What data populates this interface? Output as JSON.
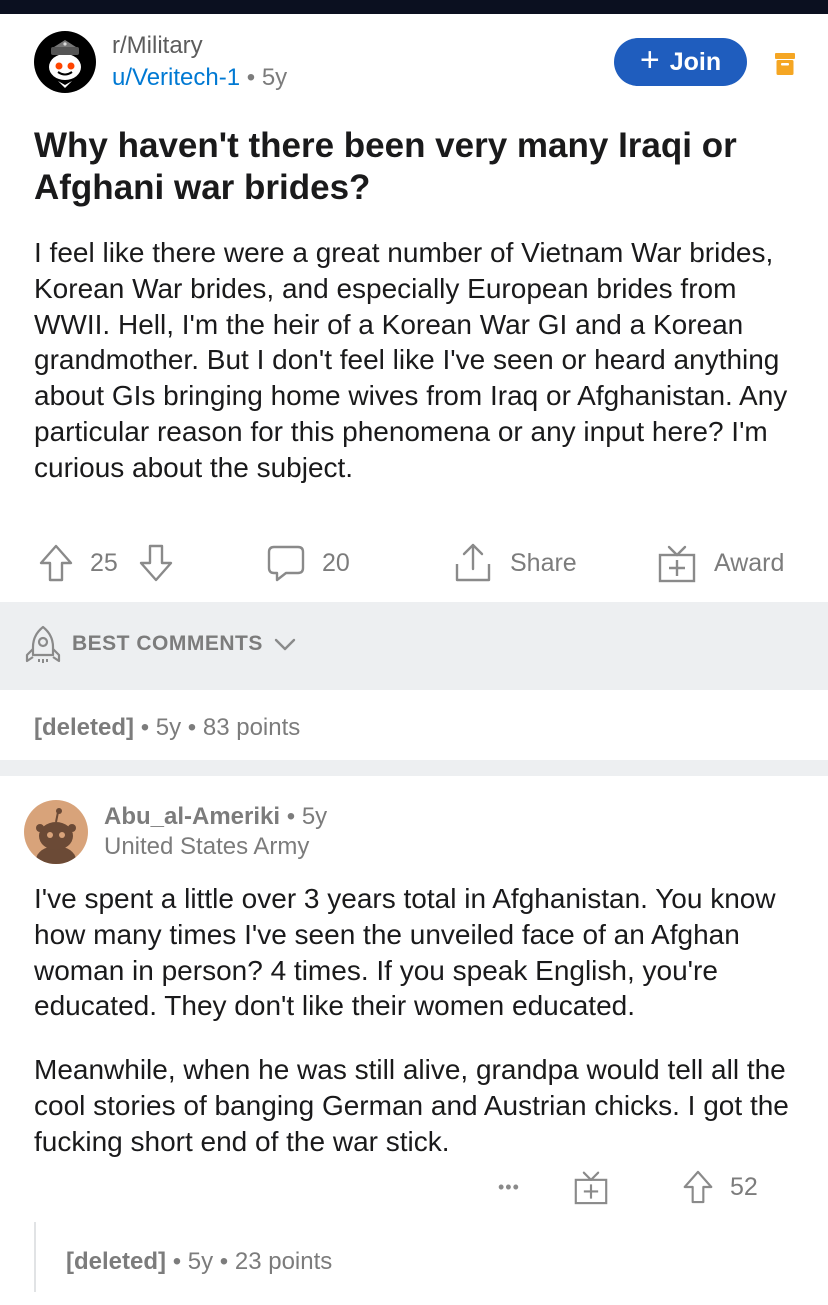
{
  "post": {
    "subreddit": "r/Military",
    "author": "u/Veritech-1",
    "separator": "•",
    "age": "5y",
    "join_label": "Join",
    "join_plus": "+",
    "title": "Why haven't there been very many Iraqi or Afghani war brides?",
    "body": "I feel like there were a great number of Vietnam War brides, Korean War brides, and especially European brides from WWII. Hell, I'm the heir of a Korean War GI and a Korean grandmother. But I don't feel like I've seen or heard anything about GIs bringing home wives from Iraq or Afghanistan. Any particular reason for this phenomena or any input here? I'm curious about the subject.",
    "votes": "25",
    "comments": "20",
    "share_label": "Share",
    "award_label": "Award"
  },
  "sort": {
    "label": "BEST COMMENTS"
  },
  "deleted_comment_1": {
    "author": "[deleted]",
    "separator": "•",
    "age": "5y",
    "points": "83 points"
  },
  "comment": {
    "author": "Abu_al-Ameriki",
    "separator": "•",
    "age": "5y",
    "flair": "United States Army",
    "paragraph_1": "I've spent a little over 3 years total in Afghanistan. You know how many times I've seen the unveiled face of an Afghan woman in person? 4 times. If you speak English, you're educated. They don't like their women educated.",
    "paragraph_2": "Meanwhile, when he was still alive, grandpa would tell all the cool stories of banging German and Austrian chicks. I got the fucking short end of the war stick.",
    "more_label": "•••",
    "votes": "52"
  },
  "deleted_comment_2": {
    "author": "[deleted]",
    "separator": "•",
    "age": "5y",
    "points": "23 points"
  },
  "colors": {
    "join_button": "#1f5dbe",
    "link_blue": "#0079d3",
    "meta_gray": "#7c7c7c",
    "band_gray": "#edeff1",
    "save_icon": "#f5a623"
  },
  "icons": [
    "subreddit-avatar",
    "save-icon",
    "upvote-icon",
    "downvote-icon",
    "comment-icon",
    "share-icon",
    "award-icon",
    "rocket-icon",
    "chevron-down-icon",
    "snoo-avatar",
    "more-icon"
  ]
}
